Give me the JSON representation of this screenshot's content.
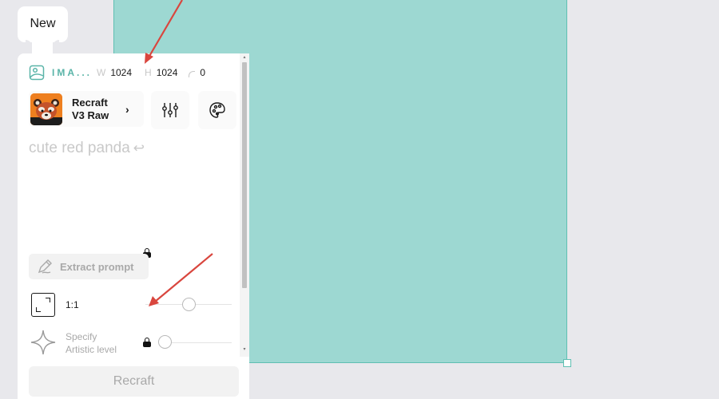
{
  "tab": {
    "label": "New"
  },
  "settings": {
    "type_label": "IMA...",
    "width_label": "W",
    "width_value": "1024",
    "height_label": "H",
    "height_value": "1024",
    "seed_value": "0"
  },
  "model": {
    "name_line1": "Recraft",
    "name_line2": "V3 Raw",
    "chevron": "›"
  },
  "prompt": {
    "text": "cute red panda",
    "enter_glyph": "↩"
  },
  "extract": {
    "label": "Extract prompt",
    "locked": true
  },
  "aspect": {
    "label": "1:1",
    "slider_value": 0.5
  },
  "artistic": {
    "label_line1": "Specify",
    "label_line2": "Artistic level",
    "locked": true,
    "slider_value": 0
  },
  "action": {
    "label": "Recraft"
  },
  "colors": {
    "accent": "#5ab4a8",
    "canvas_fill": "#9dd8d2",
    "annotation_arrow": "#d9463e"
  },
  "scroll": {
    "arrow_up": "▴",
    "arrow_down": "▾"
  }
}
